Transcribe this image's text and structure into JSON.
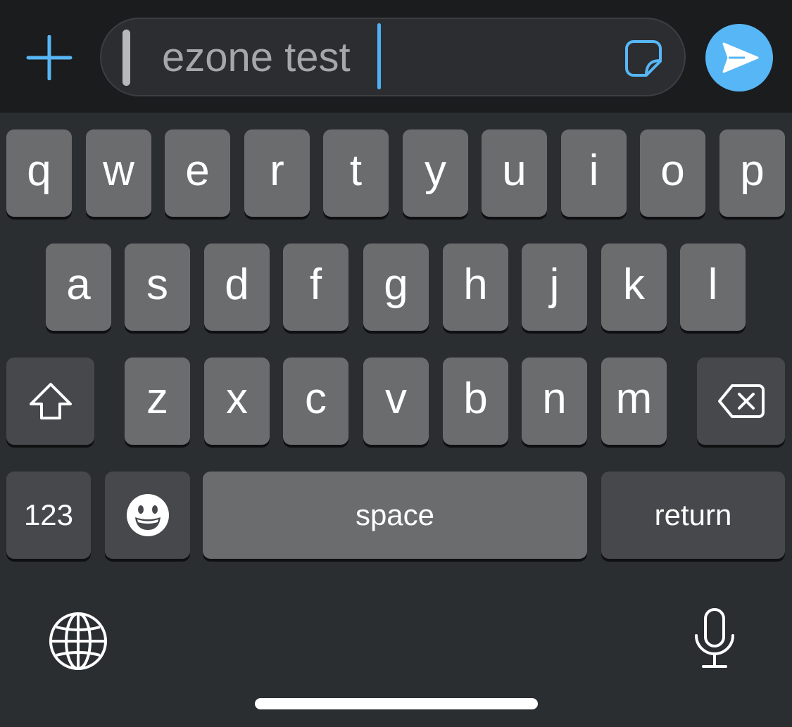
{
  "compose_bar": {
    "message_text": "ezone test",
    "plus_icon": "plus-icon",
    "sticker_icon": "sticker-icon",
    "send_icon": "send-arrow-icon",
    "accent_color": "#57b6f5"
  },
  "keyboard": {
    "row1": [
      "q",
      "w",
      "e",
      "r",
      "t",
      "y",
      "u",
      "i",
      "o",
      "p"
    ],
    "row2": [
      "a",
      "s",
      "d",
      "f",
      "g",
      "h",
      "j",
      "k",
      "l"
    ],
    "row3": [
      "z",
      "x",
      "c",
      "v",
      "b",
      "n",
      "m"
    ],
    "shift_icon": "shift-arrow-icon",
    "delete_icon": "backspace-icon",
    "numbers_label": "123",
    "emoji_icon": "emoji-smiley-icon",
    "space_label": "space",
    "return_label": "return",
    "globe_icon": "globe-icon",
    "mic_icon": "microphone-icon"
  }
}
